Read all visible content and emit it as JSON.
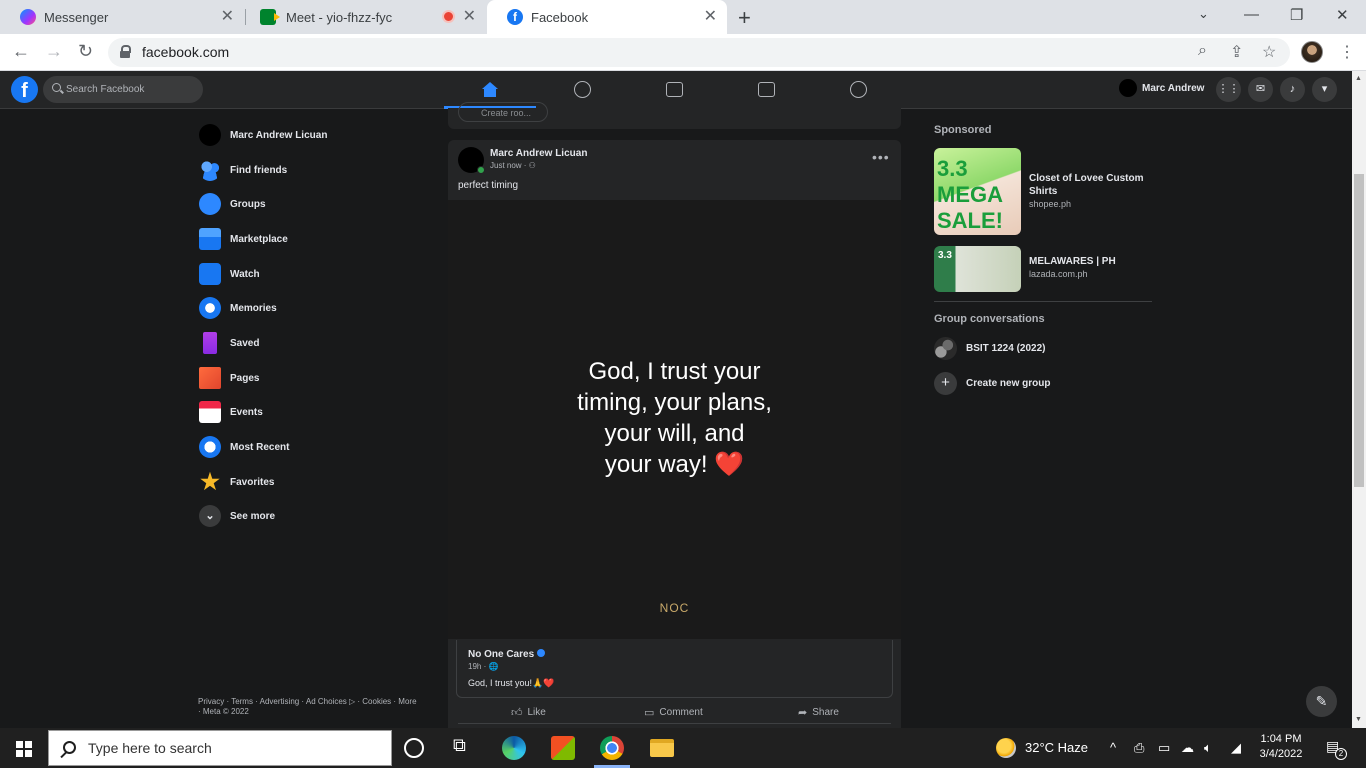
{
  "browser": {
    "tabs": [
      {
        "title": "Messenger"
      },
      {
        "title": "Meet - yio-fhzz-fyc"
      },
      {
        "title": "Facebook"
      }
    ],
    "url": "facebook.com"
  },
  "fb_header": {
    "search_placeholder": "Search Facebook",
    "user_name": "Marc Andrew"
  },
  "sidebar": {
    "profile_name": "Marc Andrew Licuan",
    "items": [
      {
        "label": "Find friends",
        "icon": "friends-icon"
      },
      {
        "label": "Groups",
        "icon": "groups-icon"
      },
      {
        "label": "Marketplace",
        "icon": "marketplace-icon"
      },
      {
        "label": "Watch",
        "icon": "watch-icon"
      },
      {
        "label": "Memories",
        "icon": "memories-icon"
      },
      {
        "label": "Saved",
        "icon": "saved-icon"
      },
      {
        "label": "Pages",
        "icon": "pages-icon"
      },
      {
        "label": "Events",
        "icon": "events-icon"
      },
      {
        "label": "Most Recent",
        "icon": "most-recent-icon"
      },
      {
        "label": "Favorites",
        "icon": "favorites-icon"
      },
      {
        "label": "See more",
        "icon": "chevron-down-icon"
      }
    ],
    "footer": "Privacy · Terms · Advertising · Ad Choices ▷ · Cookies · More · Meta © 2022"
  },
  "feed": {
    "prev_button": "Create roo...",
    "post": {
      "author": "Marc Andrew Licuan",
      "time": "Just now · ⚇",
      "caption": "perfect timing",
      "image_lines": [
        "God, I trust your",
        "timing, your plans,",
        "your will, and",
        "your way!"
      ],
      "image_emoji": "❤️",
      "image_watermark": "NOC",
      "shared_page": "No One Cares",
      "shared_time": "19h · 🌐",
      "shared_text": "God, I trust you!🙏❤️",
      "actions": {
        "like": "Like",
        "comment": "Comment",
        "share": "Share"
      }
    }
  },
  "right": {
    "sponsored_heading": "Sponsored",
    "ads": [
      {
        "title": "Closet of Lovee Custom Shirts",
        "site": "shopee.ph",
        "image_text": "3.3 MEGA SALE!"
      },
      {
        "title": "MELAWARES | PH",
        "site": "lazada.com.ph",
        "image_text": "3.3"
      }
    ],
    "groups_heading": "Group conversations",
    "groups": [
      {
        "name": "BSIT 1224 (2022)"
      }
    ],
    "create_group": "Create new group"
  },
  "taskbar": {
    "search_placeholder": "Type here to search",
    "weather": "32°C  Haze",
    "time": "1:04 PM",
    "date": "3/4/2022",
    "notification_count": "2"
  },
  "colors": {
    "fb_blue": "#1877f2",
    "nav_active": "#2d88ff",
    "fb_bg": "#18191a",
    "card_bg": "#242526"
  }
}
